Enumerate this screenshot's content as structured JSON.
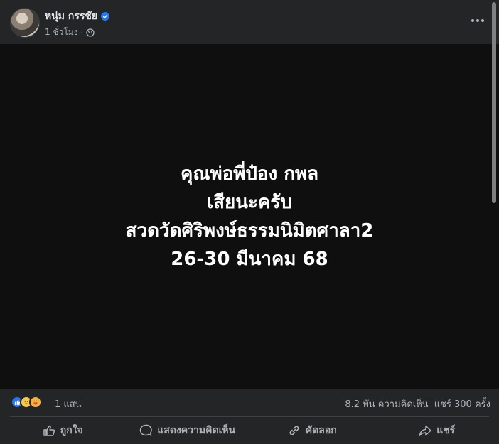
{
  "post": {
    "author_name": "หนุ่ม กรรชัย",
    "timestamp": "1 ชั่วโมง",
    "separator": "·",
    "image_text": [
      "คุณพ่อพี่ป๋อง กพล",
      "เสียนะครับ",
      "สวดวัดศิริพงษ์ธรรมนิมิตศาลา2",
      "26-30 มีนาคม 68"
    ]
  },
  "stats": {
    "reaction_count": "1 แสน",
    "comments": "8.2 พัน ความคิดเห็น",
    "shares": "แชร์ 300 ครั้ง"
  },
  "actions": {
    "like": "ถูกใจ",
    "comment": "แสดงความคิดเห็น",
    "copy": "คัดลอก",
    "share": "แชร์"
  },
  "colors": {
    "accent": "#2078f4",
    "background": "#242526",
    "image_background": "#0f0f10"
  },
  "icons": [
    "verified-icon",
    "globe-icon",
    "more-icon",
    "like-reaction-icon",
    "sad-reaction-icon",
    "care-reaction-icon",
    "like-icon",
    "comment-icon",
    "link-icon",
    "share-icon"
  ]
}
